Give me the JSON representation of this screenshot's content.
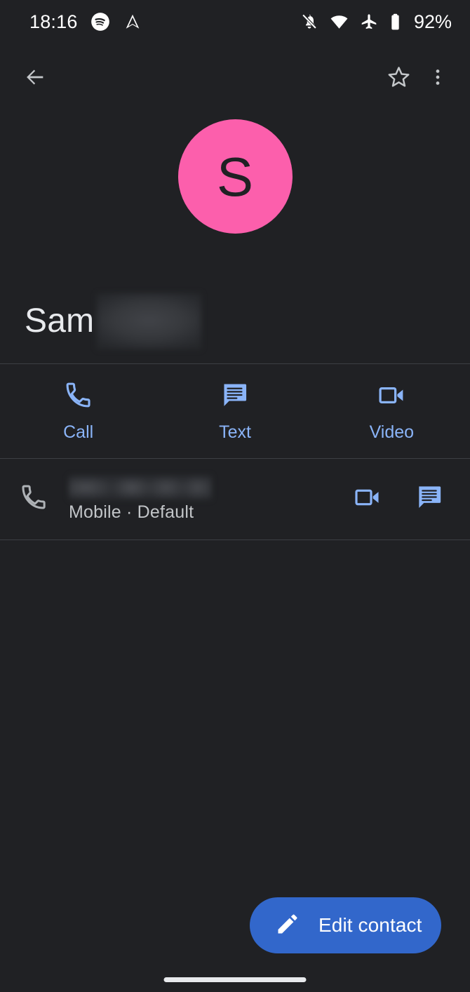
{
  "status_bar": {
    "time": "18:16",
    "battery_percent": "92%",
    "icons": [
      "spotify-icon",
      "android-auto-icon",
      "notifications-silenced-icon",
      "wifi-icon",
      "airplane-mode-icon",
      "battery-icon"
    ]
  },
  "app_bar": {
    "back_label": "Back",
    "favorite_label": "Add to favorites",
    "overflow_label": "More options"
  },
  "contact": {
    "avatar_initial": "S",
    "avatar_color": "#FC5FAC",
    "first_name": "Sam",
    "last_name_redacted": true
  },
  "quick_actions": [
    {
      "label": "Call",
      "icon": "phone-icon"
    },
    {
      "label": "Text",
      "icon": "message-icon"
    },
    {
      "label": "Video",
      "icon": "video-camera-icon"
    }
  ],
  "phone_entry": {
    "number_redacted": true,
    "subtitle": "Mobile · Default",
    "leading_icon": "phone-icon",
    "actions": [
      {
        "label": "Video call",
        "icon": "video-camera-icon"
      },
      {
        "label": "Send message",
        "icon": "message-icon"
      }
    ]
  },
  "fab": {
    "label": "Edit contact",
    "icon": "pencil-icon",
    "color": "#3267CB"
  },
  "theme": {
    "background": "#202124",
    "accent_blue": "#8AB4F8",
    "divider": "#3C3F43",
    "text_primary": "#E8EAED",
    "text_secondary": "#C2C5C8"
  }
}
